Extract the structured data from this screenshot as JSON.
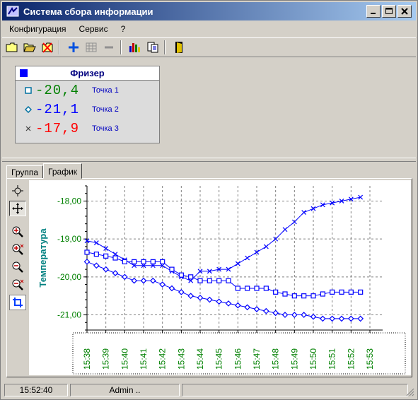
{
  "window": {
    "title": "Система сбора информации",
    "buttons": {
      "minimize": "_",
      "maximize": "□",
      "close": "×"
    }
  },
  "menu": [
    "Конфигурация",
    "Сервис",
    "?"
  ],
  "toolbar": {
    "icons": [
      "new-folder-icon",
      "open-folder-icon",
      "delete-folder-icon",
      "add-icon",
      "table-icon",
      "remove-icon",
      "bar-chart-icon",
      "report-icon",
      "exit-door-icon"
    ]
  },
  "sensor_panel": {
    "title": "Фризер",
    "points": [
      {
        "value": "-20,4",
        "name": "Точка 1",
        "color": "#008000",
        "marker": "square"
      },
      {
        "value": "-21,1",
        "name": "Точка 2",
        "color": "#0000ff",
        "marker": "diamond"
      },
      {
        "value": "-17,9",
        "name": "Точка 3",
        "color": "#ff0000",
        "marker": "cross"
      }
    ]
  },
  "tabs": [
    {
      "label": "Группа",
      "active": false
    },
    {
      "label": "График",
      "active": true
    }
  ],
  "chart_tools": [
    "select-icon",
    "pan-icon",
    "zoom-in-icon",
    "zoom-in-x-icon",
    "zoom-out-icon",
    "zoom-out-x-icon",
    "fit-icon"
  ],
  "chart_data": {
    "type": "line",
    "ylabel": "Температура",
    "xlabel": "",
    "yticks": [
      "-18,00",
      "-19,00",
      "-20,00",
      "-21,00"
    ],
    "ylim": [
      -21.4,
      -17.6
    ],
    "xticks": [
      "15:38",
      "15:39",
      "15:40",
      "15:41",
      "15:42",
      "15:43",
      "15:44",
      "15:45",
      "15:46",
      "15:47",
      "15:48",
      "15:49",
      "15:50",
      "15:51",
      "15:52",
      "15:53"
    ],
    "xlim": [
      0,
      15
    ],
    "grid": true,
    "line_color": "#0000ff",
    "series": [
      {
        "marker": "cross",
        "x": [
          0,
          0.5,
          1,
          1.5,
          2,
          2.5,
          3,
          3.5,
          4,
          4.5,
          5,
          5.5,
          6,
          6.5,
          7,
          7.5,
          8,
          8.5,
          9,
          9.5,
          10,
          10.5,
          11,
          11.5,
          12,
          12.5,
          13,
          13.5,
          14,
          14.5
        ],
        "y": [
          -19.05,
          -19.1,
          -19.25,
          -19.4,
          -19.55,
          -19.7,
          -19.7,
          -19.7,
          -19.7,
          -19.85,
          -20.0,
          -20.1,
          -19.85,
          -19.85,
          -19.8,
          -19.8,
          -19.65,
          -19.5,
          -19.35,
          -19.2,
          -19.0,
          -18.75,
          -18.55,
          -18.3,
          -18.2,
          -18.1,
          -18.05,
          -18.0,
          -17.95,
          -17.9
        ]
      },
      {
        "marker": "square",
        "x": [
          0,
          0.5,
          1,
          1.5,
          2,
          2.5,
          3,
          3.5,
          4,
          4.5,
          5,
          5.5,
          6,
          6.5,
          7,
          7.5,
          8,
          8.5,
          9,
          9.5,
          10,
          10.5,
          11,
          11.5,
          12,
          12.5,
          13,
          13.5,
          14,
          14.5
        ],
        "y": [
          -19.35,
          -19.4,
          -19.45,
          -19.5,
          -19.6,
          -19.6,
          -19.6,
          -19.6,
          -19.6,
          -19.8,
          -19.95,
          -20.0,
          -20.1,
          -20.1,
          -20.1,
          -20.1,
          -20.3,
          -20.3,
          -20.3,
          -20.3,
          -20.4,
          -20.45,
          -20.5,
          -20.5,
          -20.5,
          -20.45,
          -20.4,
          -20.4,
          -20.4,
          -20.4
        ]
      },
      {
        "marker": "diamond",
        "x": [
          0,
          0.5,
          1,
          1.5,
          2,
          2.5,
          3,
          3.5,
          4,
          4.5,
          5,
          5.5,
          6,
          6.5,
          7,
          7.5,
          8,
          8.5,
          9,
          9.5,
          10,
          10.5,
          11,
          11.5,
          12,
          12.5,
          13,
          13.5,
          14,
          14.5
        ],
        "y": [
          -19.6,
          -19.7,
          -19.8,
          -19.9,
          -20.0,
          -20.1,
          -20.1,
          -20.1,
          -20.2,
          -20.3,
          -20.4,
          -20.5,
          -20.55,
          -20.6,
          -20.65,
          -20.7,
          -20.75,
          -20.8,
          -20.85,
          -20.9,
          -20.95,
          -21.0,
          -21.0,
          -21.0,
          -21.05,
          -21.1,
          -21.1,
          -21.1,
          -21.1,
          -21.1
        ]
      }
    ]
  },
  "statusbar": {
    "time": "15:52:40",
    "user": "Admin .."
  }
}
